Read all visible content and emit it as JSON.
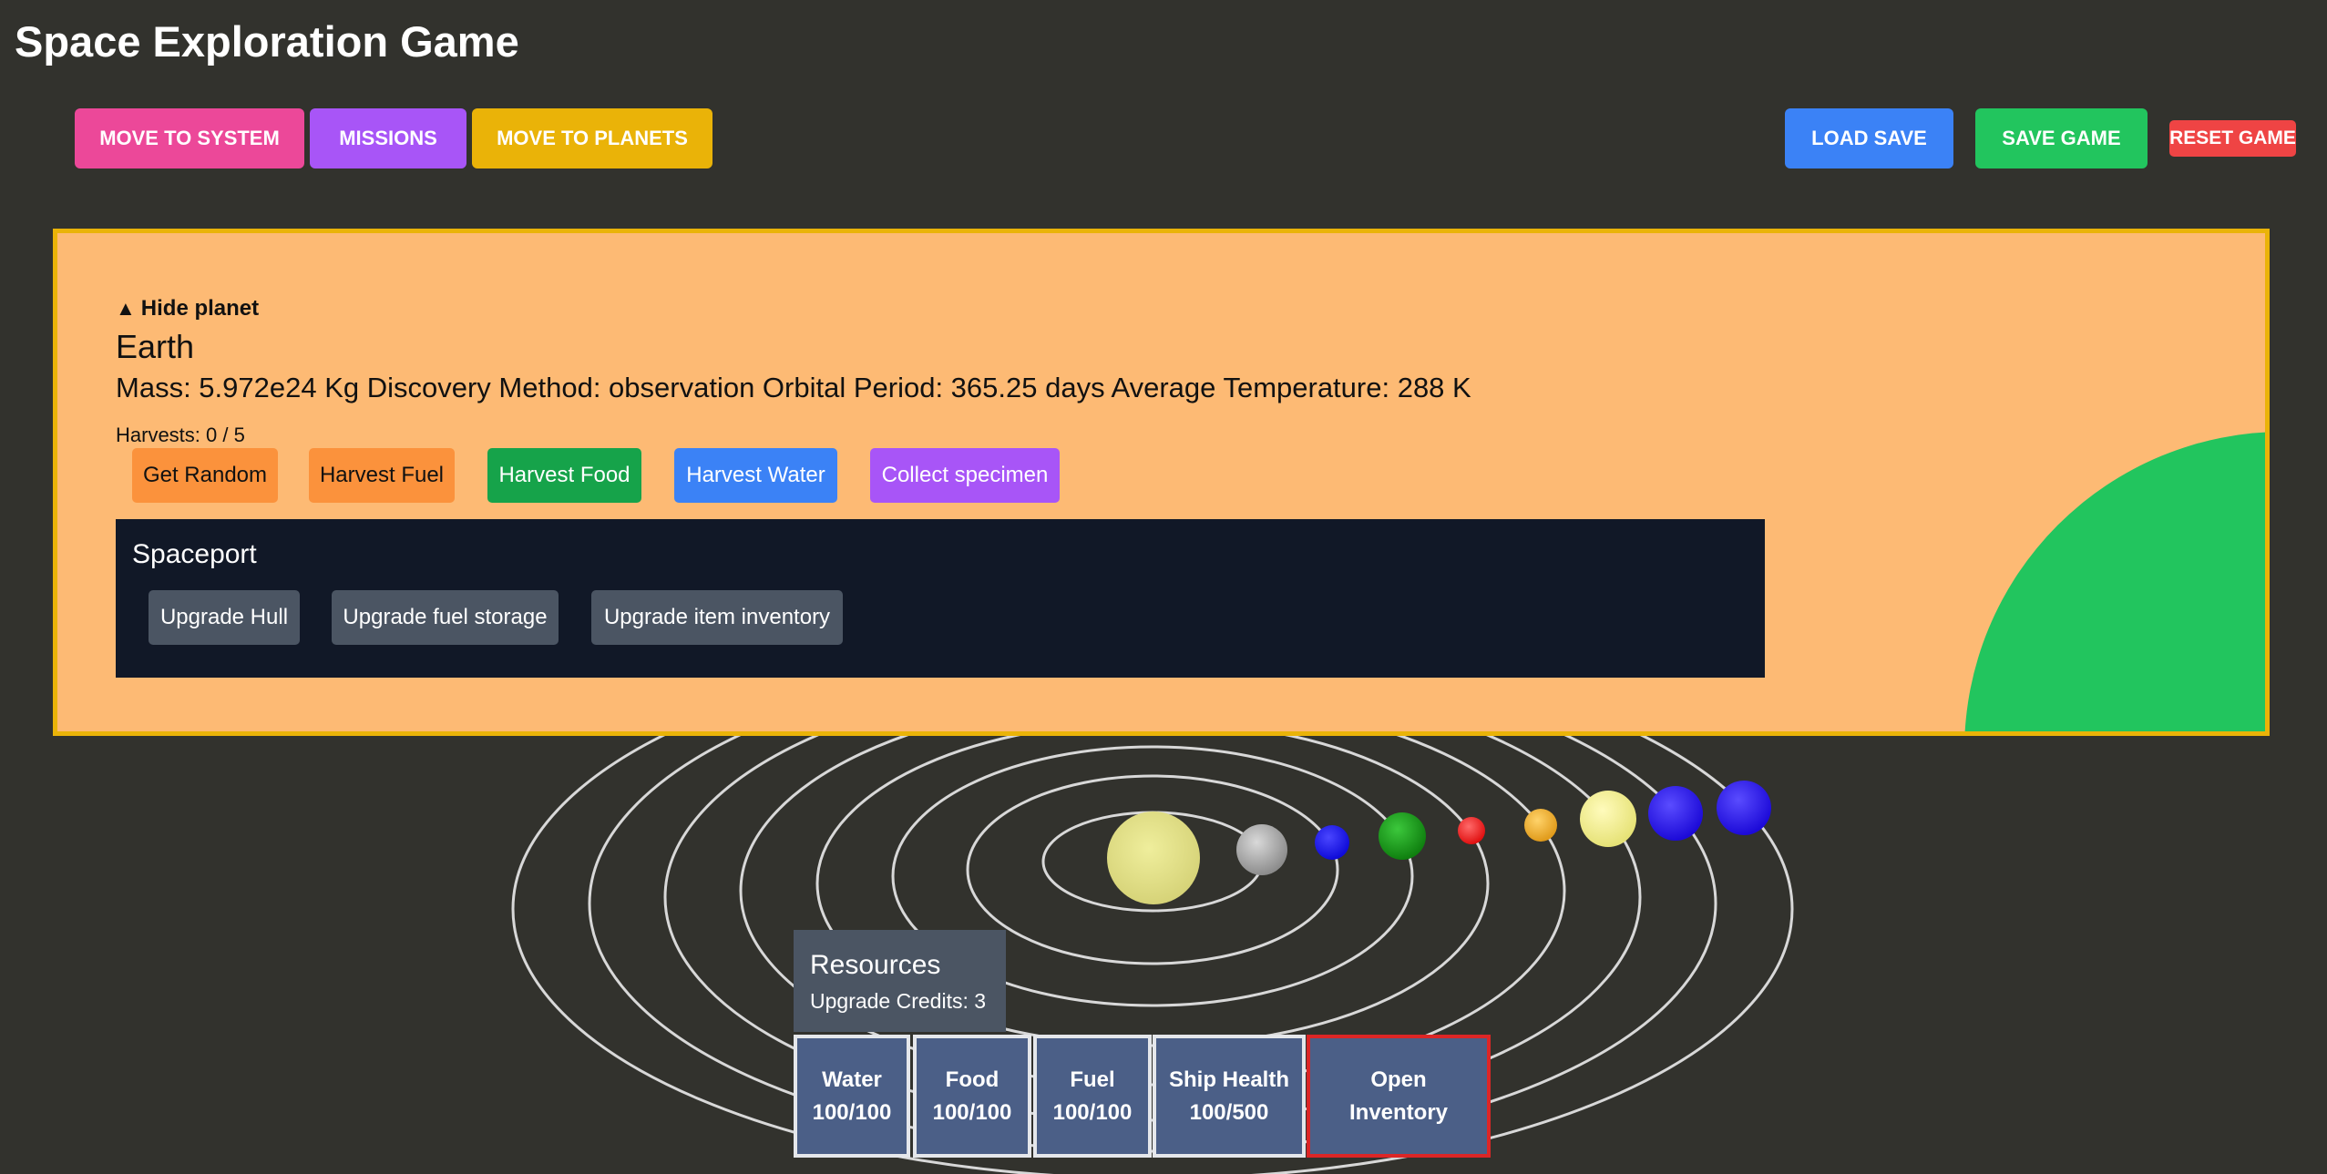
{
  "app": {
    "title": "Space Exploration Game"
  },
  "nav": {
    "move_to_system": "Move to System",
    "missions": "Missions",
    "move_to_planets": "Move to Planets",
    "load_save": "Load Save",
    "save_game": "Save Game",
    "reset_game": "Reset Game"
  },
  "planet": {
    "toggle_icon": "▲",
    "toggle_label": "Hide planet",
    "name": "Earth",
    "info": "Mass: 5.972e24 Kg Discovery Method: observation Orbital Period: 365.25 days Average Temperature: 288 K",
    "harvests": "Harvests: 0 / 5",
    "color": "#22c55e",
    "actions": {
      "get_random": "Get Random",
      "harvest_fuel": "Harvest Fuel",
      "harvest_food": "Harvest Food",
      "harvest_water": "Harvest Water",
      "collect_specimen": "Collect specimen"
    }
  },
  "spaceport": {
    "title": "Spaceport",
    "upgrade_hull": "Upgrade Hull",
    "upgrade_fuel_storage": "Upgrade fuel storage",
    "upgrade_item_inventory": "Upgrade item inventory"
  },
  "resources": {
    "title": "Resources",
    "credits": "Upgrade Credits: 3",
    "water_label": "Water",
    "water_value": "100/100",
    "food_label": "Food",
    "food_value": "100/100",
    "fuel_label": "Fuel",
    "fuel_value": "100/100",
    "health_label": "Ship Health",
    "health_value": "100/500",
    "open_inventory": "Open Inventory"
  },
  "solar_system": {
    "sun_color": "#e8e585",
    "planet_colors": [
      "#9c9c9c",
      "#1a16e8",
      "#1ea01e",
      "#ff2a2a",
      "#f2b233",
      "#f2f08a",
      "#2a18ee",
      "#2a18ee"
    ]
  }
}
